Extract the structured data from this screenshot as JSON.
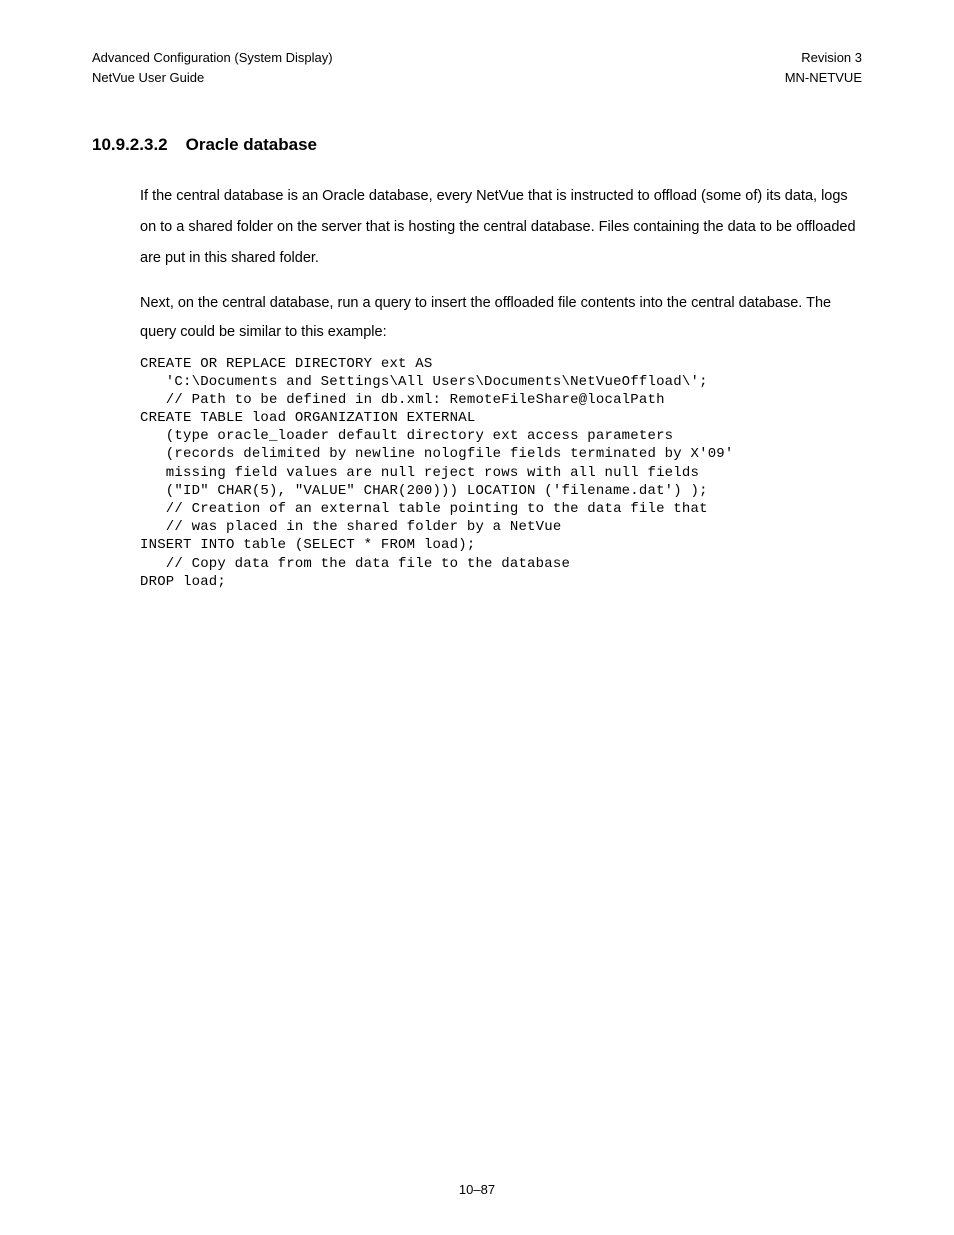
{
  "header": {
    "left_line1": "Advanced Configuration (System Display)",
    "left_line2": "NetVue User Guide",
    "right_line1": "Revision 3",
    "right_line2": "MN-NETVUE"
  },
  "section": {
    "number": "10.9.2.3.2",
    "title": "Oracle database"
  },
  "paragraphs": {
    "p1": "If the central database is an Oracle database, every NetVue that is instructed to offload (some of) its data, logs on to a shared folder on the server that is hosting the central database. Files containing the data to be offloaded are put in this shared folder.",
    "p2": "Next, on the central database, run a query to insert the offloaded file contents into the central database. The query could be similar to this example:"
  },
  "code": "CREATE OR REPLACE DIRECTORY ext AS\n   'C:\\Documents and Settings\\All Users\\Documents\\NetVueOffload\\';\n   // Path to be defined in db.xml: RemoteFileShare@localPath\nCREATE TABLE load ORGANIZATION EXTERNAL\n   (type oracle_loader default directory ext access parameters\n   (records delimited by newline nologfile fields terminated by X'09'\n   missing field values are null reject rows with all null fields\n   (\"ID\" CHAR(5), \"VALUE\" CHAR(200))) LOCATION ('filename.dat') );\n   // Creation of an external table pointing to the data file that\n   // was placed in the shared folder by a NetVue\nINSERT INTO table (SELECT * FROM load);\n   // Copy data from the data file to the database\nDROP load;",
  "footer": {
    "page": "10–87"
  }
}
